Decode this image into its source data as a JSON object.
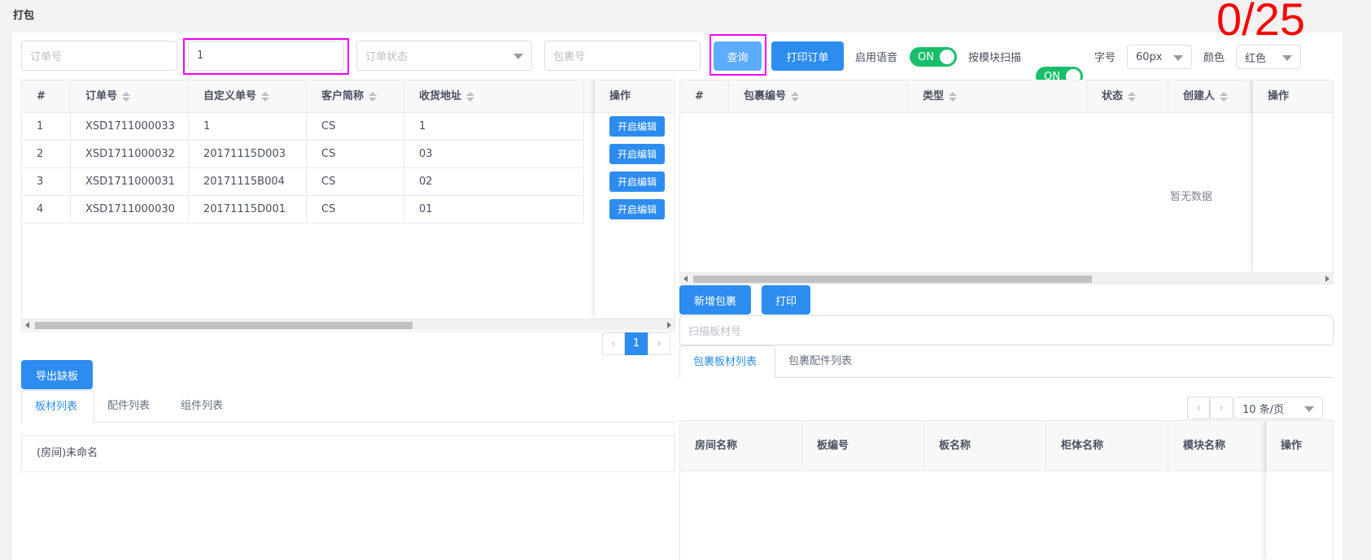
{
  "page": {
    "title": "打包",
    "counter": "0/25"
  },
  "toolbar": {
    "order_no_placeholder": "订单号",
    "custom_no_value": "1",
    "status_placeholder": "订单状态",
    "package_no_placeholder": "包裹号",
    "query_label": "查询",
    "print_order_label": "打印订单",
    "voice_label": "启用语音",
    "voice_switch": "ON",
    "module_scan_label": "按模块扫描",
    "module_scan_switch": "ON",
    "font_size_label": "字号",
    "font_size_value": "60px",
    "color_label": "颜色",
    "color_value": "红色"
  },
  "orders_table": {
    "headers": [
      "#",
      "订单号",
      "自定义单号",
      "客户简称",
      "收货地址",
      "操作"
    ],
    "rows": [
      {
        "idx": "1",
        "order": "XSD1711000033",
        "custom": "1",
        "client": "CS",
        "addr": "1",
        "action": "开启编辑"
      },
      {
        "idx": "2",
        "order": "XSD1711000032",
        "custom": "20171115D003",
        "client": "CS",
        "addr": "03",
        "action": "开启编辑"
      },
      {
        "idx": "3",
        "order": "XSD1711000031",
        "custom": "20171115B004",
        "client": "CS",
        "addr": "02",
        "action": "开启编辑"
      },
      {
        "idx": "4",
        "order": "XSD1711000030",
        "custom": "20171115D001",
        "client": "CS",
        "addr": "01",
        "action": "开启编辑"
      }
    ],
    "page": "1"
  },
  "packages_table": {
    "headers": [
      "#",
      "包裹编号",
      "类型",
      "状态",
      "创建人",
      "操作"
    ],
    "empty_text": "暂无数据"
  },
  "package_actions": {
    "add_label": "新增包裹",
    "print_label": "打印",
    "scan_placeholder": "扫描板材号"
  },
  "package_tabs": [
    "包裹板材列表",
    "包裹配件列表"
  ],
  "export_label": "导出缺板",
  "left_tabs": [
    "板材列表",
    "配件列表",
    "组件列表"
  ],
  "room_item": "(房间)未命名",
  "board_table": {
    "page_size": "10 条/页",
    "headers": [
      "房间名称",
      "板编号",
      "板名称",
      "柜体名称",
      "模块名称",
      "操作"
    ]
  }
}
